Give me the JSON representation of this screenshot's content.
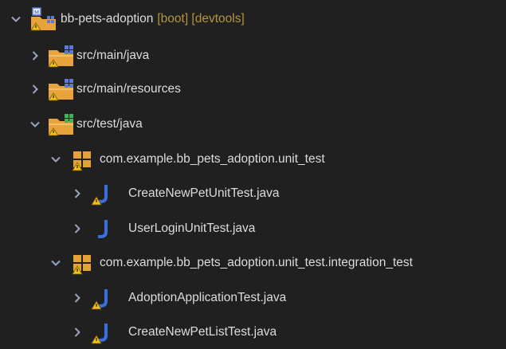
{
  "tree": {
    "project": {
      "name": "bb-pets-adoption",
      "decorations": "[boot] [devtools]",
      "expanded": true
    },
    "source_folders": [
      {
        "label": "src/main/java",
        "expanded": false
      },
      {
        "label": "src/main/resources",
        "expanded": false
      },
      {
        "label": "src/test/java",
        "expanded": true
      }
    ],
    "packages": [
      {
        "label": "com.example.bb_pets_adoption.unit_test",
        "expanded": true,
        "files": [
          {
            "label": "CreateNewPetUnitTest.java",
            "warning": true
          },
          {
            "label": "UserLoginUnitTest.java",
            "warning": false
          }
        ]
      },
      {
        "label": "com.example.bb_pets_adoption.unit_test.integration_test",
        "expanded": true,
        "files": [
          {
            "label": "AdoptionApplicationTest.java",
            "warning": true
          },
          {
            "label": "CreateNewPetListTest.java",
            "warning": true
          }
        ]
      }
    ]
  },
  "colors": {
    "background": "#202020",
    "text": "#dcdcdc",
    "decorations": "#b4963c",
    "chevron": "#9aa4c0",
    "folder": "#e8a33c",
    "package": "#e6a23a",
    "java_file": "#3a6fe0",
    "warning": "#f0c020"
  },
  "icons": {
    "project": "project-folder-icon",
    "source_folder_main": "source-folder-icon",
    "source_folder_test": "test-source-folder-icon",
    "package": "package-icon",
    "java_file": "java-file-icon",
    "warning": "warning-icon",
    "expanded": "chevron-down-icon",
    "collapsed": "chevron-right-icon"
  }
}
